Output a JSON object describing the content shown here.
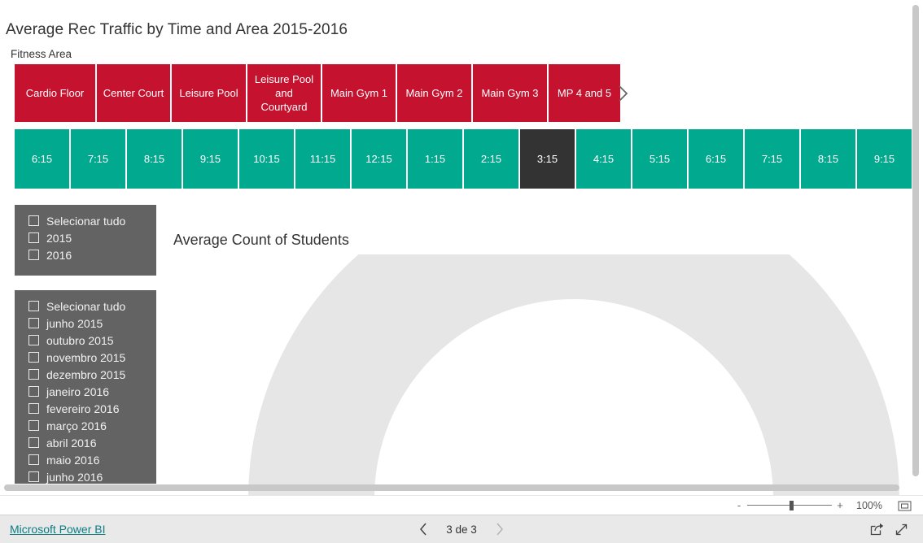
{
  "report": {
    "title": "Average Rec Traffic by Time and Area 2015-2016",
    "fitness_area_label": "Fitness Area"
  },
  "area_slicer": {
    "name": "Fitness Area",
    "next_arrow_icon": "chevron-right-icon",
    "tiles": [
      {
        "label": "Cardio Floor",
        "selected": false
      },
      {
        "label": "Center Court",
        "selected": false
      },
      {
        "label": "Leisure Pool",
        "selected": false
      },
      {
        "label": "Leisure Pool and Courtyard",
        "selected": false
      },
      {
        "label": "Main Gym 1",
        "selected": false
      },
      {
        "label": "Main Gym 2",
        "selected": false
      },
      {
        "label": "Main Gym 3",
        "selected": false
      },
      {
        "label": "MP 4 and 5",
        "selected": false
      }
    ],
    "colors": {
      "tile": "#c4122f",
      "text": "#ffffff"
    }
  },
  "time_slicer": {
    "tiles": [
      {
        "label": "6:15",
        "selected": false
      },
      {
        "label": "7:15",
        "selected": false
      },
      {
        "label": "8:15",
        "selected": false
      },
      {
        "label": "9:15",
        "selected": false
      },
      {
        "label": "10:15",
        "selected": false
      },
      {
        "label": "11:15",
        "selected": false
      },
      {
        "label": "12:15",
        "selected": false
      },
      {
        "label": "1:15",
        "selected": false
      },
      {
        "label": "2:15",
        "selected": false
      },
      {
        "label": "3:15",
        "selected": true
      },
      {
        "label": "4:15",
        "selected": false
      },
      {
        "label": "5:15",
        "selected": false
      },
      {
        "label": "6:15",
        "selected": false
      },
      {
        "label": "7:15",
        "selected": false
      },
      {
        "label": "8:15",
        "selected": false
      },
      {
        "label": "9:15",
        "selected": false
      }
    ],
    "colors": {
      "tile": "#01a98e",
      "selected": "#333333",
      "text": "#ffffff"
    }
  },
  "year_slicer": {
    "items": [
      {
        "label": "Selecionar tudo",
        "checked": false
      },
      {
        "label": "2015",
        "checked": false
      },
      {
        "label": "2016",
        "checked": false
      }
    ]
  },
  "month_slicer": {
    "items": [
      {
        "label": "Selecionar tudo",
        "checked": false
      },
      {
        "label": "junho 2015",
        "checked": false
      },
      {
        "label": "outubro 2015",
        "checked": false
      },
      {
        "label": "novembro 2015",
        "checked": false
      },
      {
        "label": "dezembro 2015",
        "checked": false
      },
      {
        "label": "janeiro 2016",
        "checked": false
      },
      {
        "label": "fevereiro 2016",
        "checked": false
      },
      {
        "label": "março 2016",
        "checked": false
      },
      {
        "label": "abril 2016",
        "checked": false
      },
      {
        "label": "maio 2016",
        "checked": false
      },
      {
        "label": "junho 2016",
        "checked": false
      }
    ]
  },
  "gauge": {
    "title": "Average Count of Students"
  },
  "chart_data": {
    "type": "gauge",
    "title": "Average Count of Students",
    "value": null,
    "value_label": "",
    "min": 0,
    "max": 100,
    "filled_fraction": 0,
    "arc_color": "#e6e6e6",
    "fill_color": "#01a98e",
    "start_angle": 180,
    "end_angle": 360,
    "note": "Semicircular gauge rendered empty (no value shown); track arc only, clipped at bottom of canvas"
  },
  "status_bar": {
    "zoom_out_label": "-",
    "zoom_in_label": "+",
    "zoom_level": "100%",
    "fit_icon": "fit-to-page-icon"
  },
  "footer": {
    "powerbi_link": "Microsoft Power BI",
    "page_indicator": "3 de 3",
    "prev_icon": "chevron-left-icon",
    "next_icon": "chevron-right-icon",
    "share_icon": "share-icon",
    "fullscreen_icon": "fullscreen-icon"
  }
}
